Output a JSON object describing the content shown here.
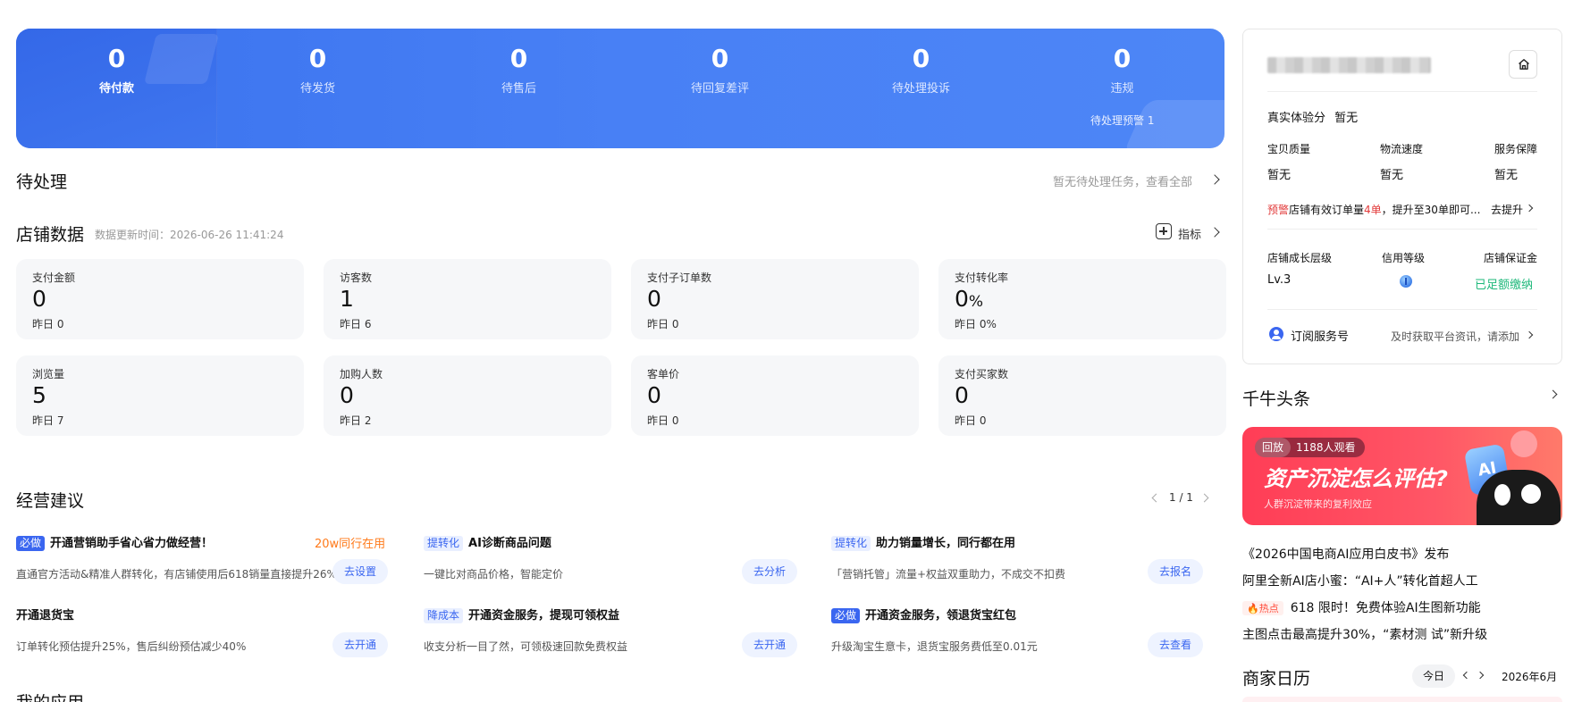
{
  "order_status": {
    "items": [
      {
        "count": "0",
        "label": "待付款"
      },
      {
        "count": "0",
        "label": "待发货"
      },
      {
        "count": "0",
        "label": "待售后"
      },
      {
        "count": "0",
        "label": "待回复差评"
      },
      {
        "count": "0",
        "label": "待处理投诉"
      },
      {
        "count": "0",
        "label": "违规"
      }
    ],
    "sub_note": "待处理预警 1"
  },
  "pending": {
    "title": "待处理",
    "link": "暂无待处理任务，查看全部"
  },
  "store_data": {
    "title": "店铺数据",
    "update_time": "数据更新时间：2026-06-26 11:41:24",
    "indicator_label": "指标",
    "cards": [
      {
        "label": "支付金额",
        "value": "0",
        "yesterday": "昨日 0"
      },
      {
        "label": "访客数",
        "value": "1",
        "yesterday": "昨日 6"
      },
      {
        "label": "支付子订单数",
        "value": "0",
        "yesterday": "昨日 0"
      },
      {
        "label": "支付转化率",
        "value": "0",
        "unit": "%",
        "yesterday": "昨日 0%"
      },
      {
        "label": "浏览量",
        "value": "5",
        "yesterday": "昨日 7"
      },
      {
        "label": "加购人数",
        "value": "0",
        "yesterday": "昨日 2"
      },
      {
        "label": "客单价",
        "value": "0",
        "yesterday": "昨日 0"
      },
      {
        "label": "支付买家数",
        "value": "0",
        "yesterday": "昨日 0"
      }
    ]
  },
  "advice": {
    "title": "经营建议",
    "pager": "1 / 1",
    "items": [
      {
        "tag": "必做",
        "tag_style": "must",
        "title": "开通营销助手省心省力做经营！",
        "extra": "20w同行在用",
        "desc": "直通官方活动&精准人群转化，有店铺使用后618销量直接提升26%",
        "button": "去设置"
      },
      {
        "tag": "提转化",
        "tag_style": "light",
        "title": "AI诊断商品问题",
        "desc": "一键比对商品价格，智能定价",
        "button": "去分析"
      },
      {
        "tag": "提转化",
        "tag_style": "light",
        "title": "助力销量增长，同行都在用",
        "desc": "「营销托管」流量+权益双重助力，不成交不扣费",
        "button": "去报名"
      },
      {
        "tag": "",
        "tag_style": "",
        "title": "开通退货宝",
        "desc": "订单转化预估提升25%，售后纠纷预估减少40%",
        "button": "去开通"
      },
      {
        "tag": "降成本",
        "tag_style": "light",
        "title": "开通资金服务，提现可领权益",
        "desc": "收支分析一目了然，可领极速回款免费权益",
        "button": "去开通"
      },
      {
        "tag": "必做",
        "tag_style": "must",
        "title": "开通资金服务，领退货宝红包",
        "desc": "升级淘宝生意卡，退货宝服务费低至0.01元",
        "button": "去查看"
      }
    ]
  },
  "my_apps": {
    "title": "我的应用"
  },
  "shop_panel": {
    "experience_label": "真实体验分",
    "experience_value": "暂无",
    "metrics": [
      {
        "label": "宝贝质量",
        "value": "暂无"
      },
      {
        "label": "物流速度",
        "value": "暂无"
      },
      {
        "label": "服务保障",
        "value": "暂无"
      }
    ],
    "warning_tag": "预警",
    "warning_pre": "店铺有效订单量",
    "warning_count": "4单",
    "warning_post": "，提升至30单即可...",
    "warning_link": "去提升",
    "levels": [
      {
        "label": "店铺成长层级",
        "value": "Lv.3"
      },
      {
        "label": "信用等级",
        "value": ""
      },
      {
        "label": "店铺保证金",
        "value": "已足额缴纳"
      }
    ],
    "subscribe_label": "订阅服务号",
    "subscribe_desc": "及时获取平台资讯，请添加"
  },
  "headlines": {
    "title": "千牛头条",
    "banner_replay": "回放",
    "banner_viewers": "1188人观看",
    "banner_title": "资产沉淀怎么评估?",
    "banner_sub": "人群沉淀带来的复利效应",
    "banner_ai": "AI",
    "news": [
      {
        "text": "《2026中国电商AI应用白皮书》发布"
      },
      {
        "text": "阿里全新AI店小蜜：“AI+人”转化首超人工"
      },
      {
        "hot": "热点",
        "text": "618 限时！免费体验AI生图新功能"
      },
      {
        "text": "主图点击最高提升30%，“素材测 试”新升级"
      }
    ]
  },
  "calendar": {
    "title": "商家日历",
    "today": "今日",
    "month": "2026年6月"
  },
  "colors": {
    "banner_blue": "#4880f5",
    "accent_blue": "#3a66f0",
    "warn_red": "#e23b3b",
    "success_green": "#1db87a",
    "orange": "#ff7a1a"
  }
}
